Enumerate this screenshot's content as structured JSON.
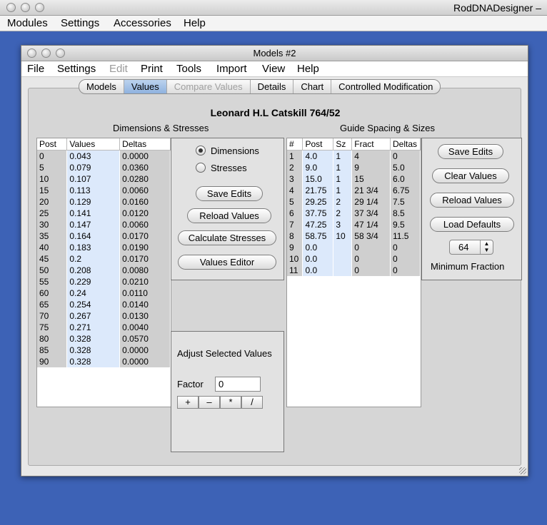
{
  "app": {
    "title": "RodDNADesigner –",
    "menu": [
      "Modules",
      "Settings",
      "Accessories",
      "Help"
    ]
  },
  "window": {
    "title": "Models #2",
    "menu": [
      "File",
      "Settings",
      "Edit",
      "Print",
      "Tools",
      "Import",
      "View",
      "Help"
    ],
    "disabled_menu": "Edit"
  },
  "tabs": [
    {
      "label": "Models",
      "state": "normal"
    },
    {
      "label": "Values",
      "state": "active"
    },
    {
      "label": "Compare Values",
      "state": "disabled"
    },
    {
      "label": "Details",
      "state": "normal"
    },
    {
      "label": "Chart",
      "state": "normal"
    },
    {
      "label": "Controlled Modification",
      "state": "normal"
    }
  ],
  "model_title": "Leonard H.L Catskill 764/52",
  "dimensions": {
    "title": "Dimensions & Stresses",
    "columns": [
      "Post",
      "Values",
      "Deltas"
    ],
    "rows": [
      [
        "0",
        "0.043",
        "0.0000"
      ],
      [
        "5",
        "0.079",
        "0.0360"
      ],
      [
        "10",
        "0.107",
        "0.0280"
      ],
      [
        "15",
        "0.113",
        "0.0060"
      ],
      [
        "20",
        "0.129",
        "0.0160"
      ],
      [
        "25",
        "0.141",
        "0.0120"
      ],
      [
        "30",
        "0.147",
        "0.0060"
      ],
      [
        "35",
        "0.164",
        "0.0170"
      ],
      [
        "40",
        "0.183",
        "0.0190"
      ],
      [
        "45",
        "0.2",
        "0.0170"
      ],
      [
        "50",
        "0.208",
        "0.0080"
      ],
      [
        "55",
        "0.229",
        "0.0210"
      ],
      [
        "60",
        "0.24",
        "0.0110"
      ],
      [
        "65",
        "0.254",
        "0.0140"
      ],
      [
        "70",
        "0.267",
        "0.0130"
      ],
      [
        "75",
        "0.271",
        "0.0040"
      ],
      [
        "80",
        "0.328",
        "0.0570"
      ],
      [
        "85",
        "0.328",
        "0.0000"
      ],
      [
        "90",
        "0.328",
        "0.0000"
      ]
    ],
    "mode_options": [
      "Dimensions",
      "Stresses"
    ],
    "selected_mode": "Dimensions",
    "buttons": {
      "save": "Save Edits",
      "reload": "Reload Values",
      "calculate": "Calculate Stresses",
      "editor": "Values Editor"
    }
  },
  "adjust": {
    "title": "Adjust Selected Values",
    "factor_label": "Factor",
    "factor_value": "0",
    "ops": [
      "+",
      "–",
      "*",
      "/"
    ]
  },
  "guides": {
    "title": "Guide Spacing & Sizes",
    "columns": [
      "#",
      "Post",
      "Sz",
      "Fract",
      "Deltas"
    ],
    "rows": [
      [
        "1",
        "4.0",
        "1",
        "4",
        "0"
      ],
      [
        "2",
        "9.0",
        "1",
        "9",
        "5.0"
      ],
      [
        "3",
        "15.0",
        "1",
        "15",
        "6.0"
      ],
      [
        "4",
        "21.75",
        "1",
        "21 3/4",
        "6.75"
      ],
      [
        "5",
        "29.25",
        "2",
        "29 1/4",
        "7.5"
      ],
      [
        "6",
        "37.75",
        "2",
        "37 3/4",
        "8.5"
      ],
      [
        "7",
        "47.25",
        "3",
        "47 1/4",
        "9.5"
      ],
      [
        "8",
        "58.75",
        "10",
        "58 3/4",
        "11.5"
      ],
      [
        "9",
        "0.0",
        "",
        "0",
        "0"
      ],
      [
        "10",
        "0.0",
        "",
        "0",
        "0"
      ],
      [
        "11",
        "0.0",
        "",
        "0",
        "0"
      ]
    ],
    "buttons": {
      "save": "Save Edits",
      "clear": "Clear Values",
      "reload": "Reload Values",
      "defaults": "Load Defaults"
    },
    "min_fraction_value": "64",
    "min_fraction_label": "Minimum Fraction"
  }
}
